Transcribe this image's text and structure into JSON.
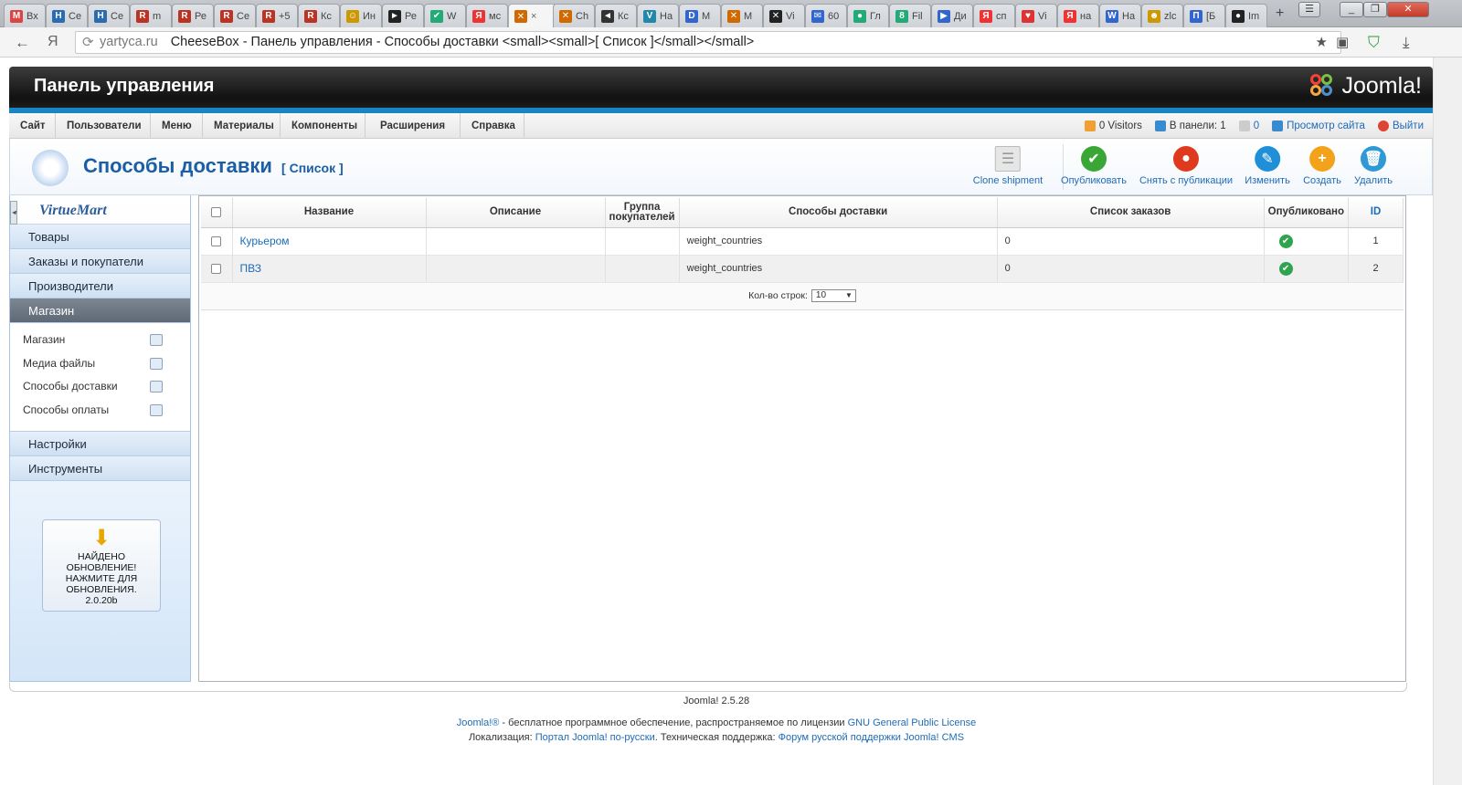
{
  "browser": {
    "tabs": [
      {
        "fav": "M",
        "color": "#d44",
        "label": "Вх"
      },
      {
        "fav": "H",
        "color": "#2b6cb0",
        "label": "Се"
      },
      {
        "fav": "H",
        "color": "#2b6cb0",
        "label": "Се"
      },
      {
        "fav": "R",
        "color": "#b32",
        "label": "m"
      },
      {
        "fav": "R",
        "color": "#b32",
        "label": "Ре"
      },
      {
        "fav": "R",
        "color": "#b32",
        "label": "Се"
      },
      {
        "fav": "R",
        "color": "#b32",
        "label": "+5"
      },
      {
        "fav": "R",
        "color": "#b32",
        "label": "Кс"
      },
      {
        "fav": "☺",
        "color": "#c90",
        "label": "Ин"
      },
      {
        "fav": "►",
        "color": "#222",
        "label": "Ре"
      },
      {
        "fav": "✔",
        "color": "#2a7",
        "label": "W"
      },
      {
        "fav": "Я",
        "color": "#e33",
        "label": "мс"
      },
      {
        "fav": "✕",
        "color": "#d06a00",
        "label": "×"
      },
      {
        "fav": "✕",
        "color": "#d06a00",
        "label": "Ch"
      },
      {
        "fav": "◄",
        "color": "#333",
        "label": "Кс"
      },
      {
        "fav": "V",
        "color": "#28a",
        "label": "На"
      },
      {
        "fav": "D",
        "color": "#36c",
        "label": "М"
      },
      {
        "fav": "✕",
        "color": "#d06a00",
        "label": "М"
      },
      {
        "fav": "✕",
        "color": "#222",
        "label": "Vi"
      },
      {
        "fav": "✉",
        "color": "#36c",
        "label": "60"
      },
      {
        "fav": "●",
        "color": "#2a7",
        "label": "Гл"
      },
      {
        "fav": "8",
        "color": "#2a7",
        "label": "Fil"
      },
      {
        "fav": "▶",
        "color": "#36c",
        "label": "Ди"
      },
      {
        "fav": "Я",
        "color": "#e33",
        "label": "сп"
      },
      {
        "fav": "♥",
        "color": "#d33",
        "label": "Vi"
      },
      {
        "fav": "Я",
        "color": "#e33",
        "label": "на"
      },
      {
        "fav": "W",
        "color": "#36c",
        "label": "На"
      },
      {
        "fav": "☻",
        "color": "#c90",
        "label": "zlc"
      },
      {
        "fav": "П",
        "color": "#36c",
        "label": "[Б"
      },
      {
        "fav": "●",
        "color": "#222",
        "label": "Im"
      }
    ],
    "active_tab_index": 12,
    "url_host": "yartyca.ru",
    "url_title": "CheeseBox - Панель управления - Способы доставки <small><small>[ Список ]</small></small>"
  },
  "header": {
    "title": "Панель управления",
    "logo_text": "Joomla!"
  },
  "menu": {
    "items": [
      "Сайт",
      "Пользователи",
      "Меню",
      "Материалы",
      "Компоненты",
      "Расширения",
      "Справка"
    ],
    "status": {
      "visitors": "0 Visitors",
      "in_panel": "В панели: 1",
      "messages": "0",
      "view_site": "Просмотр сайта",
      "logout": "Выйти"
    }
  },
  "toolbar": {
    "page_title": "Способы доставки",
    "page_subtitle": "[ Список ]",
    "buttons": [
      {
        "label": "Clone shipment",
        "icon": "clone-icon",
        "color": "#e6e6e6"
      },
      {
        "label": "Опубликовать",
        "icon": "publish-icon",
        "color": "#3aa635"
      },
      {
        "label": "Снять с публикации",
        "icon": "unpublish-icon",
        "color": "#e03a1e"
      },
      {
        "label": "Изменить",
        "icon": "edit-icon",
        "color": "#1f8fd8"
      },
      {
        "label": "Создать",
        "icon": "new-icon",
        "color": "#f3a21b"
      },
      {
        "label": "Удалить",
        "icon": "delete-icon",
        "color": "#2f98d6"
      }
    ]
  },
  "sidebar": {
    "logo": "VirtueMart",
    "items_top": [
      "Товары",
      "Заказы и покупатели",
      "Производители",
      "Магазин"
    ],
    "active": "Магазин",
    "subitems": [
      "Магазин",
      "Медиа файлы",
      "Способы доставки",
      "Способы оплаты"
    ],
    "items_bottom": [
      "Настройки",
      "Инструменты"
    ],
    "update": {
      "line1": "НАЙДЕНО",
      "line2": "ОБНОВЛЕНИЕ!",
      "line3": "НАЖМИТЕ ДЛЯ",
      "line4": "ОБНОВЛЕНИЯ.",
      "version": "2.0.20b"
    }
  },
  "table": {
    "headers": {
      "name": "Название",
      "description": "Описание",
      "group_l1": "Группа",
      "group_l2": "покупателей",
      "method": "Способы доставки",
      "order_list": "Список заказов",
      "published": "Опубликовано",
      "id": "ID"
    },
    "rows": [
      {
        "name": "Курьером",
        "description": "",
        "group": "",
        "method": "weight_countries",
        "orders": "0",
        "published": true,
        "id": "1"
      },
      {
        "name": "ПВЗ",
        "description": "",
        "group": "",
        "method": "weight_countries",
        "orders": "0",
        "published": true,
        "id": "2"
      }
    ],
    "pager_label": "Кол-во строк:",
    "pager_value": "10"
  },
  "footer": {
    "version": "Joomla! 2.5.28",
    "line1_link1": "Joomla!®",
    "line1_text": " - бесплатное программное обеспечение, распространяемое по лицензии ",
    "line1_link2": "GNU General Public License",
    "line2_text1": "Локализация: ",
    "line2_link1": "Портал Joomla! по-русски",
    "line2_text2": ". Техническая поддержка: ",
    "line2_link2": "Форум русской поддержки Joomla! CMS"
  }
}
